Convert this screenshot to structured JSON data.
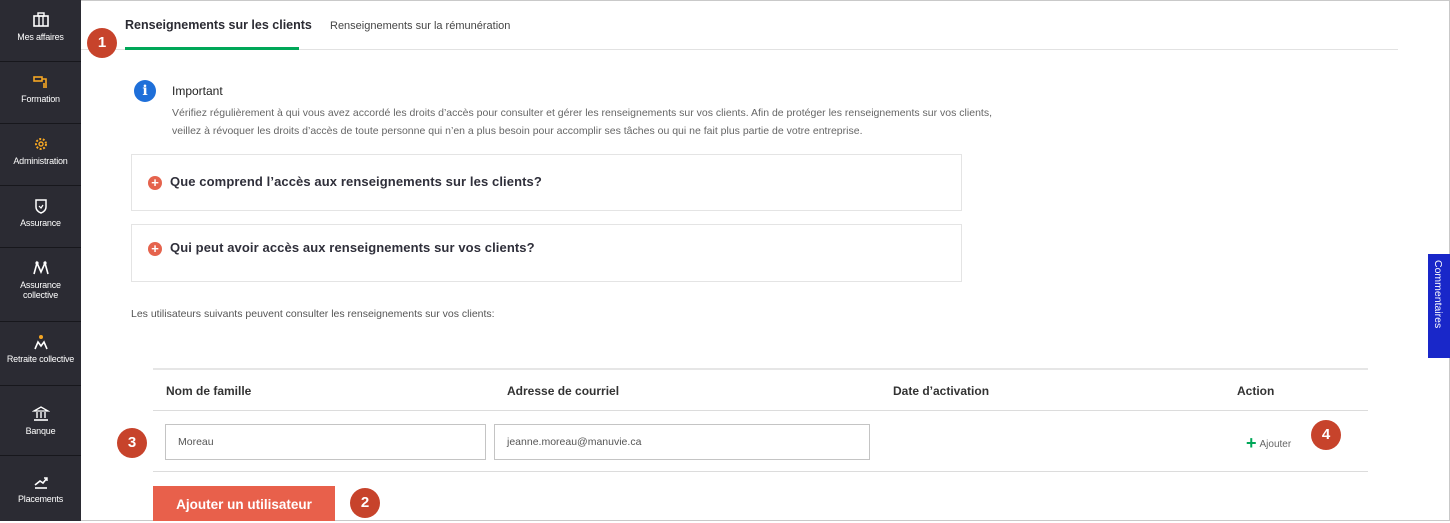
{
  "sidebar": {
    "items": [
      {
        "label": "Mes affaires",
        "icon": "briefcase-icon"
      },
      {
        "label": "Formation",
        "icon": "training-icon"
      },
      {
        "label": "Administration",
        "icon": "gear-icon"
      },
      {
        "label": "Assurance",
        "icon": "shield-icon"
      },
      {
        "label": "Assurance collective",
        "icon": "group-icon"
      },
      {
        "label": "Retraite collective",
        "icon": "retirement-icon"
      },
      {
        "label": "Banque",
        "icon": "bank-icon"
      },
      {
        "label": "Placements",
        "icon": "chart-up-icon"
      }
    ]
  },
  "tabs": [
    {
      "label": "Renseignements sur les clients",
      "active": true
    },
    {
      "label": "Renseignements sur la rémunération",
      "active": false
    }
  ],
  "badges": [
    "1",
    "2",
    "3",
    "4"
  ],
  "info": {
    "title": "Important",
    "text": "Vérifiez régulièrement à qui vous avez accordé les droits d’accès pour consulter et gérer les renseignements sur vos clients. Afin de protéger les renseignements sur vos clients, veillez à révoquer les droits d’accès de toute personne qui n’en a plus besoin pour accomplir ses tâches ou qui ne fait plus partie de votre entreprise."
  },
  "accordions": [
    {
      "title": "Que comprend l’accès aux renseignements sur les clients?"
    },
    {
      "title": "Qui peut avoir accès aux renseignements sur vos clients?"
    }
  ],
  "lead_text": "Les utilisateurs suivants peuvent consulter les renseignements sur vos clients:",
  "table": {
    "headers": [
      "Nom de famille",
      "Adresse de courriel",
      "Date d’activation",
      "Action"
    ],
    "row": {
      "last_name_value": "Moreau",
      "email_value": "jeanne.moreau@manuvie.ca",
      "add_label": "Ajouter",
      "add_symbol": "+"
    }
  },
  "add_user_label": "Ajouter un utilisateur",
  "feedback_label": "Commentaires",
  "colors": {
    "sidebar_bg": "#2b2b33",
    "accent_green": "#00a758",
    "accent_coral": "#e8604b",
    "badge_red": "#c7432b",
    "info_blue": "#1e6fd9",
    "feedback_blue": "#1927c9",
    "icon_orange": "#f5a623"
  }
}
